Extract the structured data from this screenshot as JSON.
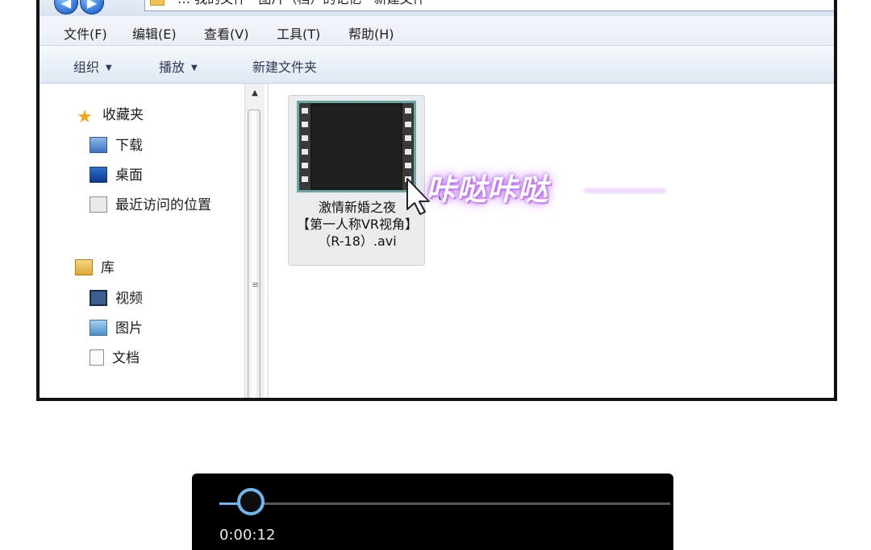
{
  "address_bar": {
    "path": "… 我的文件 · 图片（档）的记忆 · 新建文件"
  },
  "menu": {
    "items": [
      "文件(F)",
      "编辑(E)",
      "查看(V)",
      "工具(T)",
      "帮助(H)"
    ]
  },
  "toolbar": {
    "organize": "组织",
    "play": "播放",
    "new_folder": "新建文件夹"
  },
  "sidebar": {
    "favorites": {
      "label": "收藏夹",
      "items": [
        "下载",
        "桌面",
        "最近访问的位置"
      ]
    },
    "libraries": {
      "label": "库",
      "items": [
        "视频",
        "图片",
        "文档"
      ]
    }
  },
  "file": {
    "name_line1": "激情新婚之夜",
    "name_line2": "【第一人称VR视角】",
    "name_line3": "（R-18）.avi",
    "icon": "video-film-icon"
  },
  "sticker": {
    "text": "咔哒咔哒"
  },
  "player": {
    "timecode": "0:00:12",
    "progress_fraction": 0.07,
    "accent": "#6fb6ef"
  }
}
